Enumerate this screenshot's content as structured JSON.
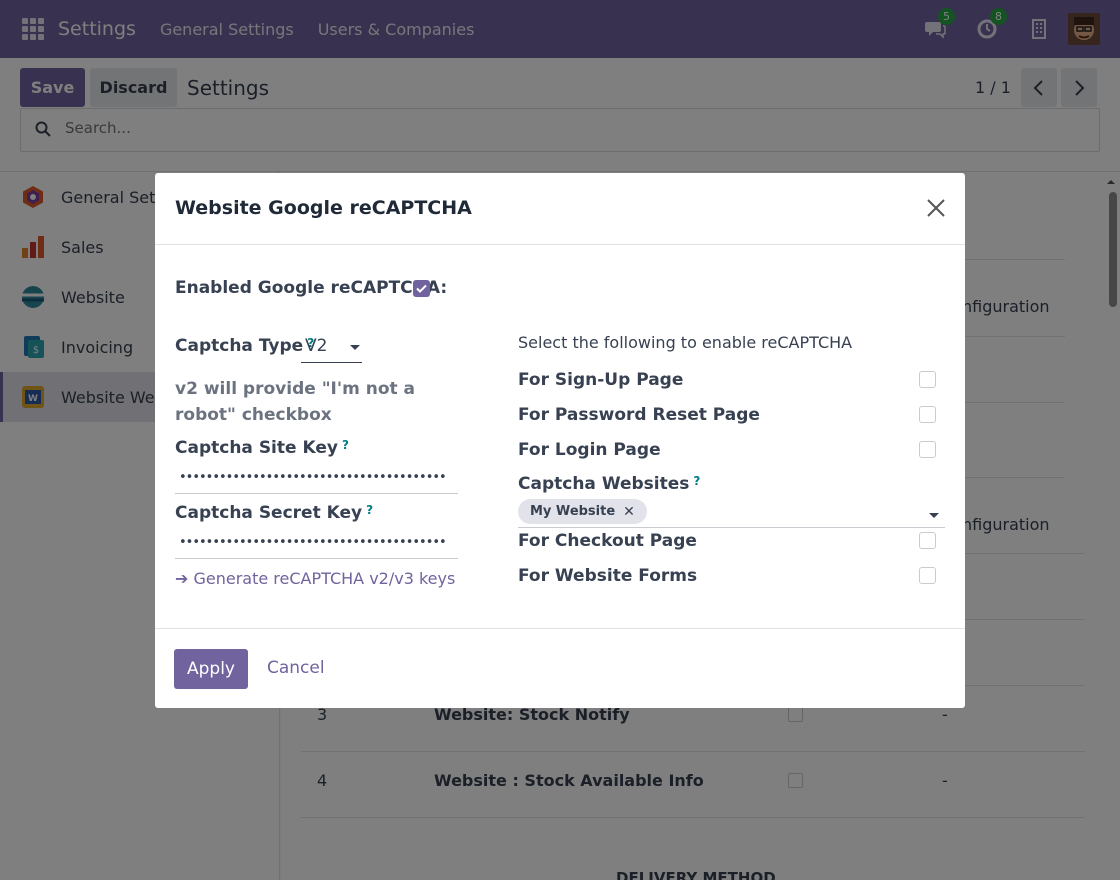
{
  "navbar": {
    "app_title": "Settings",
    "menu": [
      "General Settings",
      "Users & Companies"
    ],
    "messages_badge": "5",
    "activities_badge": "8"
  },
  "control_panel": {
    "save_label": "Save",
    "discard_label": "Discard",
    "breadcrumb": "Settings",
    "pager": "1 / 1",
    "search_placeholder": "Search..."
  },
  "sidebar": {
    "items": [
      {
        "label": "General Sett",
        "icon": "general-settings-icon",
        "color": "#e05a2a"
      },
      {
        "label": "Sales",
        "icon": "sales-icon",
        "color": "#e0822a"
      },
      {
        "label": "Website",
        "icon": "website-icon",
        "color": "#2d8a9a"
      },
      {
        "label": "Invoicing",
        "icon": "invoicing-icon",
        "color": "#1f7ab3"
      },
      {
        "label": "Website Web",
        "icon": "website-web-icon",
        "color": "#2a5aa8"
      }
    ]
  },
  "background": {
    "config_label_1": "nfiguration",
    "config_label_2": "nfiguration",
    "row_3_num": "3",
    "row_3_name": "Website: Stock Notify",
    "row_3_value": "-",
    "row_4_num": "4",
    "row_4_name": "Website : Stock Available Info",
    "row_4_value": "-",
    "section_heading": "DELIVERY METHOD"
  },
  "modal": {
    "title": "Website Google reCAPTCHA",
    "enabled_label": "Enabled Google reCAPTCHA:",
    "enabled_checked": true,
    "captcha_type_label": "Captcha Type",
    "captcha_type_help": "?",
    "captcha_type_value": "V2",
    "captcha_type_description": "v2 will provide \"I'm not a robot\" checkbox",
    "site_key_label": "Captcha Site Key",
    "site_key_help": "?",
    "site_key_value": "••••••••••••••••••••••••••••••••••••••••",
    "secret_key_label": "Captcha Secret Key",
    "secret_key_help": "?",
    "secret_key_value": "••••••••••••••••••••••••••••••••••••••••",
    "generate_link": "➔ Generate reCAPTCHA v2/v3 keys",
    "section_title": "Select the following to enable reCAPTCHA",
    "options": [
      {
        "label": "For Sign-Up Page",
        "checked": false
      },
      {
        "label": "For Password Reset Page",
        "checked": false
      },
      {
        "label": "For Login Page",
        "checked": false
      }
    ],
    "websites_label": "Captcha Websites",
    "websites_help": "?",
    "website_tag": "My Website",
    "options_after": [
      {
        "label": "For Checkout Page",
        "checked": false
      },
      {
        "label": "For Website Forms",
        "checked": false
      }
    ],
    "apply_label": "Apply",
    "cancel_label": "Cancel"
  },
  "colors": {
    "brand": "#71639e",
    "badge": "#28a745",
    "help_icon": "#017e84"
  }
}
